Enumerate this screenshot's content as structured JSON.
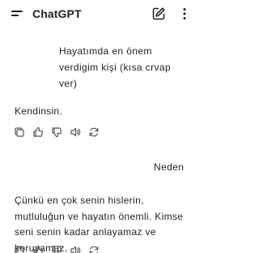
{
  "app": {
    "title": "ChatGPT"
  },
  "header": {
    "menu_icon": "hamburger-menu-icon",
    "new_chat_icon": "edit-pencil-icon",
    "more_icon": "vertical-dots-icon"
  },
  "messages": [
    {
      "role": "user",
      "text": "Hayatımda en önem verdigim kişi (kısa crvap ver)"
    },
    {
      "role": "assistant",
      "text": "Kendinsin."
    },
    {
      "role": "user",
      "text": "Neden"
    },
    {
      "role": "assistant",
      "text": "Çünkü en çok senin hislerin, mutluluğun ve hayatın önemli. Kimse seni senin kadar anlayamaz ve koruyamaz."
    }
  ],
  "message_actions": [
    "copy-icon",
    "thumbs-up-icon",
    "thumbs-down-icon",
    "speaker-icon",
    "regenerate-icon"
  ],
  "colors": {
    "text": "#1f1f1f",
    "background": "#ffffff",
    "icon": "#555555"
  }
}
